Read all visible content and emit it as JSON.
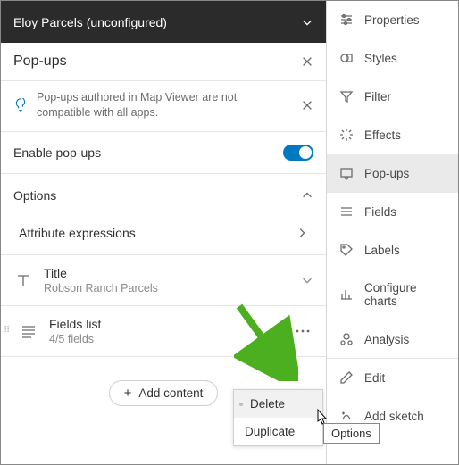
{
  "layer": {
    "title": "Eloy Parcels (unconfigured)"
  },
  "panel": {
    "title": "Pop-ups",
    "info": "Pop-ups authored in Map Viewer are not compatible with all apps.",
    "enable_label": "Enable pop-ups",
    "options_label": "Options",
    "attr_expr_label": "Attribute expressions"
  },
  "cards": {
    "title": {
      "label": "Title",
      "sub": "Robson Ranch Parcels"
    },
    "fields": {
      "label": "Fields list",
      "sub": "4/5 fields"
    }
  },
  "add_content_label": "Add content",
  "context_menu": {
    "delete": "Delete",
    "duplicate": "Duplicate"
  },
  "tooltip": "Options",
  "rail": {
    "properties": "Properties",
    "styles": "Styles",
    "filter": "Filter",
    "effects": "Effects",
    "popups": "Pop-ups",
    "fields": "Fields",
    "labels": "Labels",
    "charts": "Configure charts",
    "analysis": "Analysis",
    "edit": "Edit",
    "sketch": "Add sketch"
  }
}
